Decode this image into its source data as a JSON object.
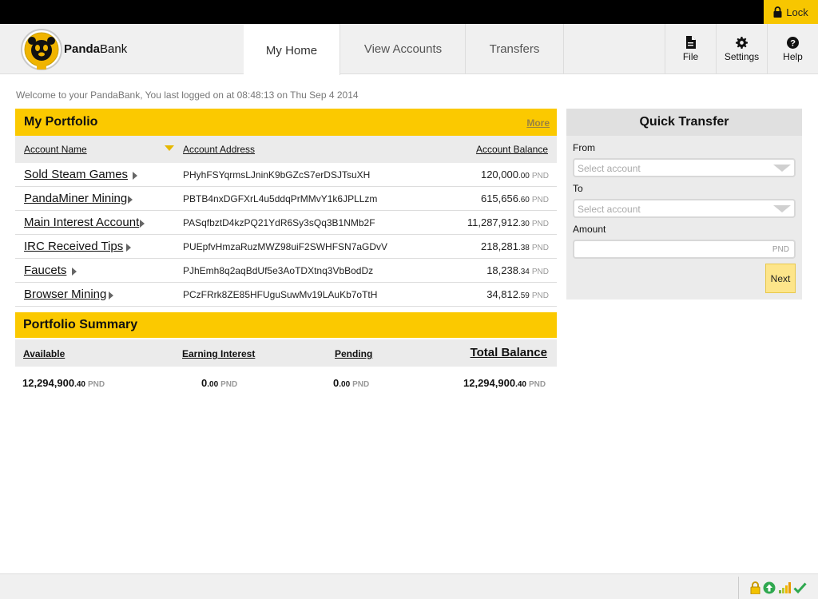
{
  "topbar": {
    "lock_label": "Lock"
  },
  "header": {
    "brand_bold": "Panda",
    "brand_rest": "Bank",
    "tabs": [
      "My Home",
      "View Accounts",
      "Transfers"
    ],
    "tools": [
      "File",
      "Settings",
      "Help"
    ]
  },
  "welcome": "Welcome to your PandaBank, You last logged on at 08:48:13 on Thu Sep 4 2014",
  "portfolio": {
    "title": "My Portfolio",
    "more": "More",
    "columns": [
      "Account Name",
      "Account Address",
      "Account Balance"
    ],
    "rows": [
      {
        "name": "Sold Steam Games",
        "address": "PHyhFSYqrmsLJninK9bGZcS7erDSJTsuXH",
        "whole": "120,000",
        "dec": ".00",
        "cur": "PND"
      },
      {
        "name": "PandaMiner Mining",
        "address": "PBTB4nxDGFXrL4u5ddqPrMMvY1k6JPLLzm",
        "whole": "615,656",
        "dec": ".60",
        "cur": "PND"
      },
      {
        "name": "Main Interest Account",
        "address": "PASqfbztD4kzPQ21YdR6Sy3sQq3B1NMb2F",
        "whole": "11,287,912",
        "dec": ".30",
        "cur": "PND"
      },
      {
        "name": "IRC Received Tips",
        "address": "PUEpfvHmzaRuzMWZ98uiF2SWHFSN7aGDvV",
        "whole": "218,281",
        "dec": ".38",
        "cur": "PND"
      },
      {
        "name": "Faucets",
        "address": "PJhEmh8q2aqBdUf5e3AoTDXtnq3VbBodDz",
        "whole": "18,238",
        "dec": ".34",
        "cur": "PND"
      },
      {
        "name": "Browser Mining",
        "address": "PCzFRrk8ZE85HFUguSuwMv19LAuKb7oTtH",
        "whole": "34,812",
        "dec": ".59",
        "cur": "PND"
      }
    ]
  },
  "summary": {
    "title": "Portfolio Summary",
    "headers": [
      "Available",
      "Earning Interest",
      "Pending",
      "Total Balance"
    ],
    "values": [
      {
        "whole": "12,294,900",
        "dec": ".40",
        "cur": "PND"
      },
      {
        "whole": "0",
        "dec": ".00",
        "cur": "PND"
      },
      {
        "whole": "0",
        "dec": ".00",
        "cur": "PND"
      },
      {
        "whole": "12,294,900",
        "dec": ".40",
        "cur": "PND"
      }
    ]
  },
  "quick_transfer": {
    "title": "Quick Transfer",
    "from_label": "From",
    "from_placeholder": "Select account",
    "to_label": "To",
    "to_placeholder": "Select account",
    "amount_label": "Amount",
    "amount_currency": "PND",
    "next_label": "Next"
  },
  "colors": {
    "accent": "#fbc900",
    "topbar": "#000000",
    "panel_grey": "#ebebeb"
  }
}
